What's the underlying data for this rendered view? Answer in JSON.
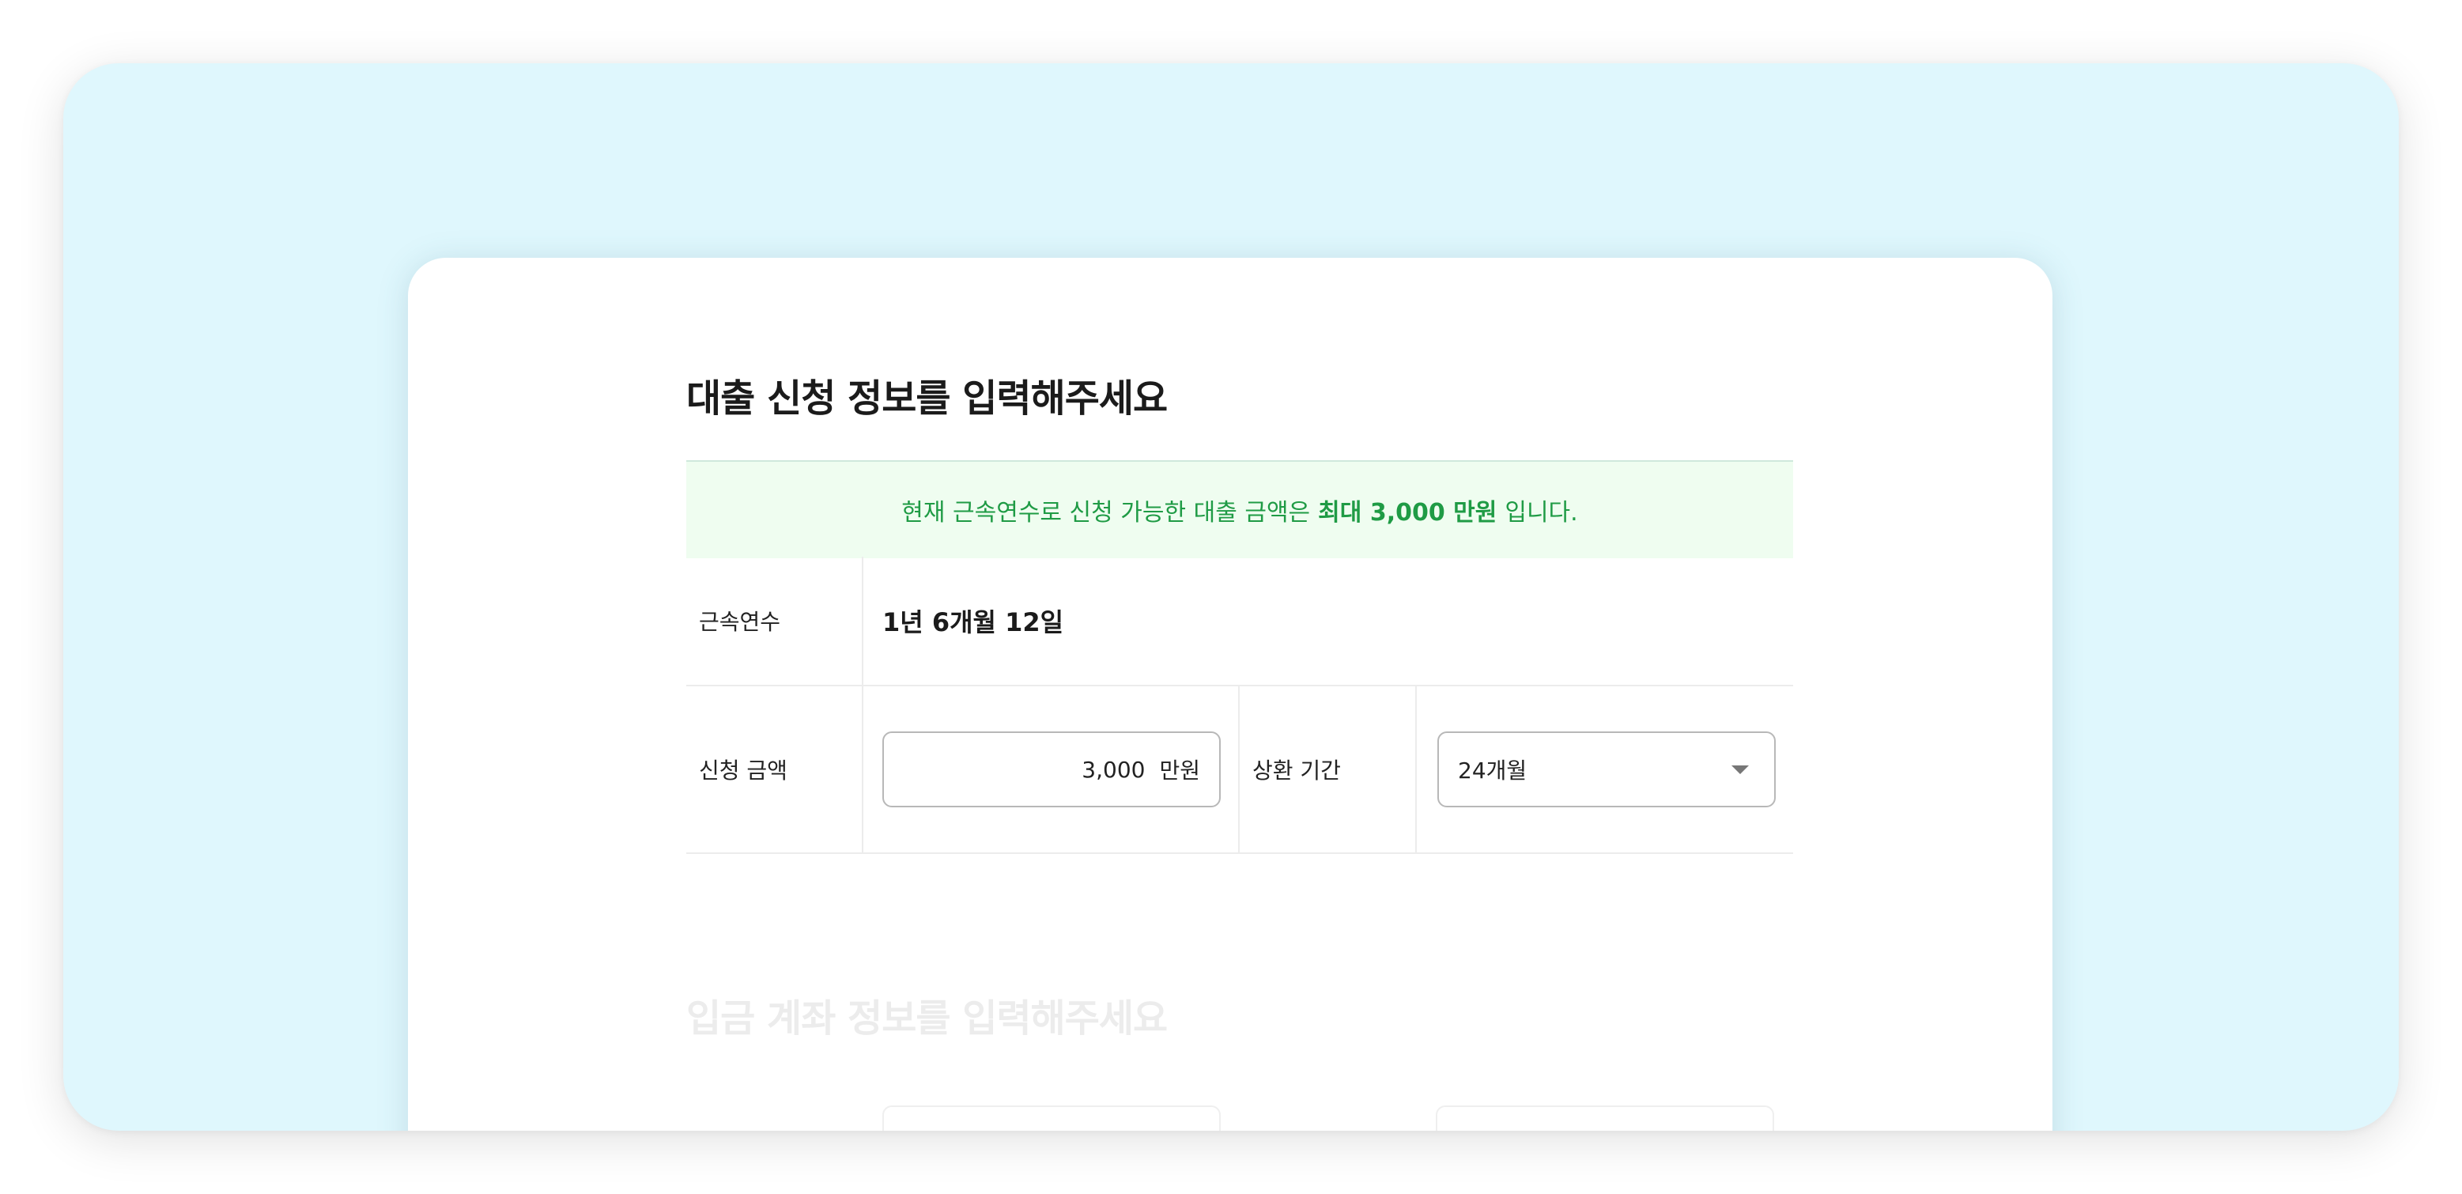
{
  "loan_section": {
    "title": "대출 신청 정보를 입력해주세요",
    "notice": {
      "prefix": "현재 근속연수로 신청 가능한 대출 금액은",
      "highlight": "최대 3,000 만원",
      "suffix": "입니다."
    },
    "tenure": {
      "label": "근속연수",
      "value": "1년 6개월 12일"
    },
    "amount": {
      "label": "신청 금액",
      "value": "3,000",
      "unit": "만원"
    },
    "repayment": {
      "label": "상환 기간",
      "selected": "24개월"
    }
  },
  "deposit_section": {
    "title": "입금 계좌 정보를 입력해주세요"
  },
  "colors": {
    "background": "#dff7fd",
    "notice_bg": "#effdf0",
    "notice_text": "#1f9b45"
  }
}
